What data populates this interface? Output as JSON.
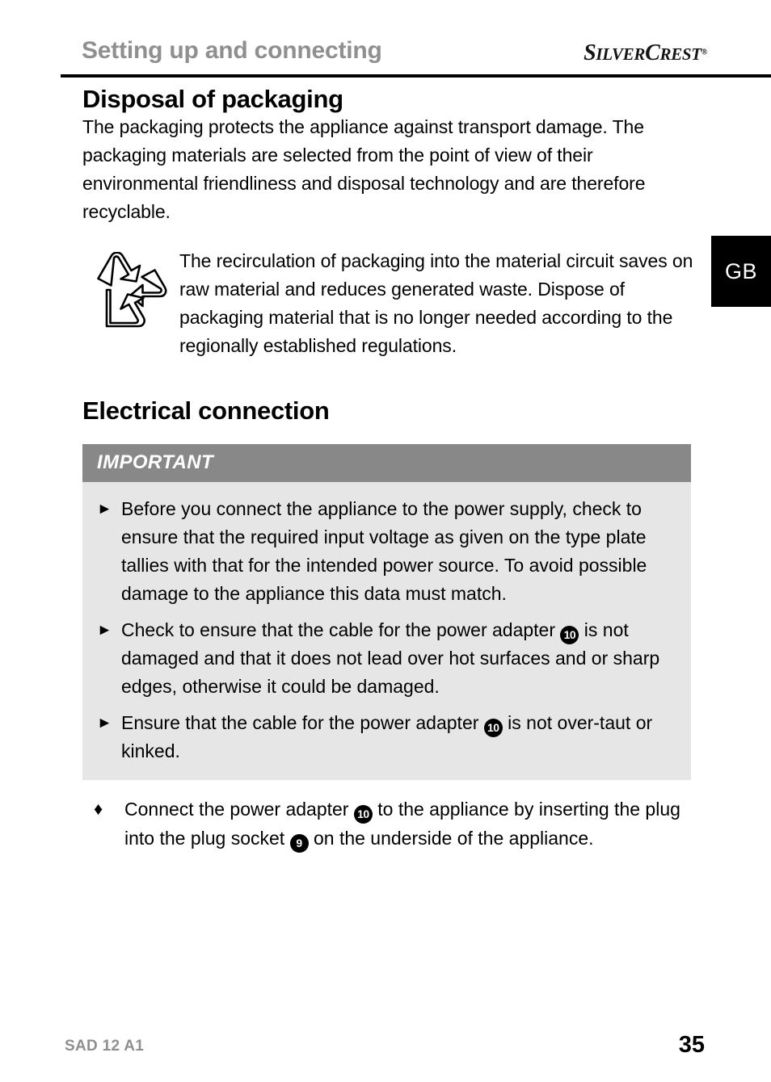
{
  "header": {
    "running_title": "Setting up and connecting",
    "brand": {
      "part1_big": "S",
      "part1_small": "ILVER",
      "part2_big": "C",
      "part2_small": "REST",
      "registered": "®"
    }
  },
  "language_tab": {
    "label": "GB"
  },
  "sections": {
    "disposal": {
      "title": "Disposal of packaging",
      "intro": "The packaging protects the appliance against transport damage. The packaging materials are selected from the point of view of their environmental friendliness and disposal technology and are therefore recyclable.",
      "recycle_icon_name": "recycling-symbol",
      "recycle_text": "The recirculation of packaging into the material circuit saves on raw material and reduces generated waste. Dispose of packaging material that is no longer needed according to the regionally established regulations."
    },
    "electrical": {
      "title": "Electrical connection",
      "important_box": {
        "header": "IMPORTANT",
        "marker": "►",
        "items": [
          {
            "segments": [
              {
                "type": "text",
                "value": "Before you connect the appliance to the power supply, check to ensure that the required input voltage as given on the type plate tallies with that for the intended power source. To avoid possible damage to the appliance this data must match."
              }
            ]
          },
          {
            "segments": [
              {
                "type": "text",
                "value": "Check to ensure that the cable for the power adapter "
              },
              {
                "type": "ref",
                "value": "10"
              },
              {
                "type": "text",
                "value": " is not damaged and that it does not lead over hot surfaces and or sharp edges, otherwise it could be damaged."
              }
            ]
          },
          {
            "segments": [
              {
                "type": "text",
                "value": "Ensure that the cable for the power adapter "
              },
              {
                "type": "ref",
                "value": "10"
              },
              {
                "type": "text",
                "value": " is not over-taut or kinked."
              }
            ]
          }
        ]
      },
      "action": {
        "marker": "♦",
        "segments": [
          {
            "type": "text",
            "value": "Connect the power adapter "
          },
          {
            "type": "ref",
            "value": "10"
          },
          {
            "type": "text",
            "value": " to the appliance by inserting the plug into the plug socket "
          },
          {
            "type": "ref",
            "value": "9"
          },
          {
            "type": "text",
            "value": " on the underside of the appliance."
          }
        ]
      }
    }
  },
  "footer": {
    "model": "SAD 12 A1",
    "page_number": "35"
  },
  "colors": {
    "running_head_gray": "#8f8f8f",
    "important_header_gray": "#888888",
    "important_body_gray": "#e6e6e6",
    "ink_black": "#000000"
  }
}
